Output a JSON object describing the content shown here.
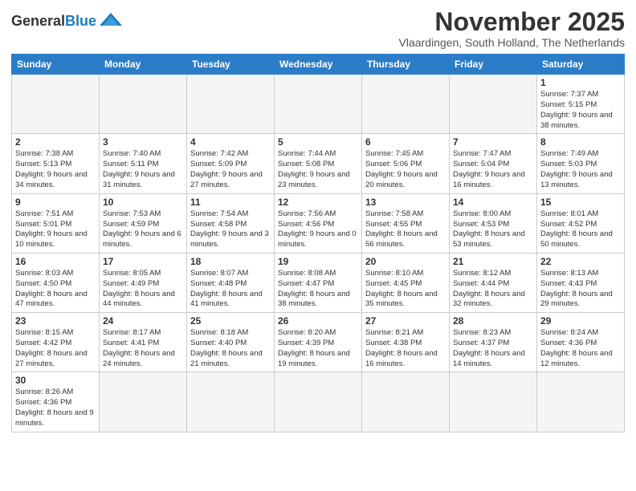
{
  "logo": {
    "general": "General",
    "blue": "Blue"
  },
  "title": "November 2025",
  "subtitle": "Vlaardingen, South Holland, The Netherlands",
  "days_of_week": [
    "Sunday",
    "Monday",
    "Tuesday",
    "Wednesday",
    "Thursday",
    "Friday",
    "Saturday"
  ],
  "weeks": [
    [
      {
        "day": "",
        "info": ""
      },
      {
        "day": "",
        "info": ""
      },
      {
        "day": "",
        "info": ""
      },
      {
        "day": "",
        "info": ""
      },
      {
        "day": "",
        "info": ""
      },
      {
        "day": "",
        "info": ""
      },
      {
        "day": "1",
        "info": "Sunrise: 7:37 AM\nSunset: 5:15 PM\nDaylight: 9 hours\nand 38 minutes."
      }
    ],
    [
      {
        "day": "2",
        "info": "Sunrise: 7:38 AM\nSunset: 5:13 PM\nDaylight: 9 hours\nand 34 minutes."
      },
      {
        "day": "3",
        "info": "Sunrise: 7:40 AM\nSunset: 5:11 PM\nDaylight: 9 hours\nand 31 minutes."
      },
      {
        "day": "4",
        "info": "Sunrise: 7:42 AM\nSunset: 5:09 PM\nDaylight: 9 hours\nand 27 minutes."
      },
      {
        "day": "5",
        "info": "Sunrise: 7:44 AM\nSunset: 5:08 PM\nDaylight: 9 hours\nand 23 minutes."
      },
      {
        "day": "6",
        "info": "Sunrise: 7:45 AM\nSunset: 5:06 PM\nDaylight: 9 hours\nand 20 minutes."
      },
      {
        "day": "7",
        "info": "Sunrise: 7:47 AM\nSunset: 5:04 PM\nDaylight: 9 hours\nand 16 minutes."
      },
      {
        "day": "8",
        "info": "Sunrise: 7:49 AM\nSunset: 5:03 PM\nDaylight: 9 hours\nand 13 minutes."
      }
    ],
    [
      {
        "day": "9",
        "info": "Sunrise: 7:51 AM\nSunset: 5:01 PM\nDaylight: 9 hours\nand 10 minutes."
      },
      {
        "day": "10",
        "info": "Sunrise: 7:53 AM\nSunset: 4:59 PM\nDaylight: 9 hours\nand 6 minutes."
      },
      {
        "day": "11",
        "info": "Sunrise: 7:54 AM\nSunset: 4:58 PM\nDaylight: 9 hours\nand 3 minutes."
      },
      {
        "day": "12",
        "info": "Sunrise: 7:56 AM\nSunset: 4:56 PM\nDaylight: 9 hours\nand 0 minutes."
      },
      {
        "day": "13",
        "info": "Sunrise: 7:58 AM\nSunset: 4:55 PM\nDaylight: 8 hours\nand 56 minutes."
      },
      {
        "day": "14",
        "info": "Sunrise: 8:00 AM\nSunset: 4:53 PM\nDaylight: 8 hours\nand 53 minutes."
      },
      {
        "day": "15",
        "info": "Sunrise: 8:01 AM\nSunset: 4:52 PM\nDaylight: 8 hours\nand 50 minutes."
      }
    ],
    [
      {
        "day": "16",
        "info": "Sunrise: 8:03 AM\nSunset: 4:50 PM\nDaylight: 8 hours\nand 47 minutes."
      },
      {
        "day": "17",
        "info": "Sunrise: 8:05 AM\nSunset: 4:49 PM\nDaylight: 8 hours\nand 44 minutes."
      },
      {
        "day": "18",
        "info": "Sunrise: 8:07 AM\nSunset: 4:48 PM\nDaylight: 8 hours\nand 41 minutes."
      },
      {
        "day": "19",
        "info": "Sunrise: 8:08 AM\nSunset: 4:47 PM\nDaylight: 8 hours\nand 38 minutes."
      },
      {
        "day": "20",
        "info": "Sunrise: 8:10 AM\nSunset: 4:45 PM\nDaylight: 8 hours\nand 35 minutes."
      },
      {
        "day": "21",
        "info": "Sunrise: 8:12 AM\nSunset: 4:44 PM\nDaylight: 8 hours\nand 32 minutes."
      },
      {
        "day": "22",
        "info": "Sunrise: 8:13 AM\nSunset: 4:43 PM\nDaylight: 8 hours\nand 29 minutes."
      }
    ],
    [
      {
        "day": "23",
        "info": "Sunrise: 8:15 AM\nSunset: 4:42 PM\nDaylight: 8 hours\nand 27 minutes."
      },
      {
        "day": "24",
        "info": "Sunrise: 8:17 AM\nSunset: 4:41 PM\nDaylight: 8 hours\nand 24 minutes."
      },
      {
        "day": "25",
        "info": "Sunrise: 8:18 AM\nSunset: 4:40 PM\nDaylight: 8 hours\nand 21 minutes."
      },
      {
        "day": "26",
        "info": "Sunrise: 8:20 AM\nSunset: 4:39 PM\nDaylight: 8 hours\nand 19 minutes."
      },
      {
        "day": "27",
        "info": "Sunrise: 8:21 AM\nSunset: 4:38 PM\nDaylight: 8 hours\nand 16 minutes."
      },
      {
        "day": "28",
        "info": "Sunrise: 8:23 AM\nSunset: 4:37 PM\nDaylight: 8 hours\nand 14 minutes."
      },
      {
        "day": "29",
        "info": "Sunrise: 8:24 AM\nSunset: 4:36 PM\nDaylight: 8 hours\nand 12 minutes."
      }
    ],
    [
      {
        "day": "30",
        "info": "Sunrise: 8:26 AM\nSunset: 4:36 PM\nDaylight: 8 hours\nand 9 minutes."
      },
      {
        "day": "",
        "info": ""
      },
      {
        "day": "",
        "info": ""
      },
      {
        "day": "",
        "info": ""
      },
      {
        "day": "",
        "info": ""
      },
      {
        "day": "",
        "info": ""
      },
      {
        "day": "",
        "info": ""
      }
    ]
  ]
}
